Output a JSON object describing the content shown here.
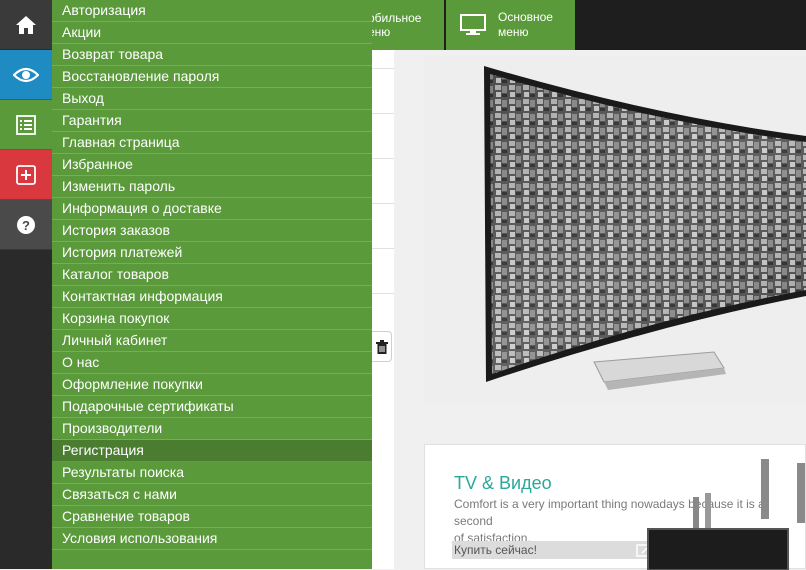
{
  "rail": {
    "items": [
      {
        "icon": "home-icon",
        "color": "#3a3a3a"
      },
      {
        "icon": "eye-icon",
        "color": "#1e8bc3"
      },
      {
        "icon": "list-icon",
        "color": "#5a9a3a"
      },
      {
        "icon": "plus-square-icon",
        "color": "#d9393e"
      },
      {
        "icon": "question-circle-icon",
        "color": "#4a4a4a"
      }
    ]
  },
  "menu": {
    "items": [
      "Авторизация",
      "Акции",
      "Возврат товара",
      "Восстановление пароля",
      "Выход",
      "Гарантия",
      "Главная страница",
      "Избранное",
      "Изменить пароль",
      "Информация о доставке",
      "История заказов",
      "История платежей",
      "Каталог товаров",
      "Контактная информация",
      "Корзина покупок",
      "Личный кабинет",
      "О нас",
      "Оформление покупки",
      "Подарочные сертификаты",
      "Производители",
      "Регистрация",
      "Результаты поиска",
      "Связаться с нами",
      "Сравнение товаров",
      "Условия использования"
    ],
    "active_index": 20
  },
  "topnav": {
    "mobile_line1": "обильное",
    "mobile_line2": "еню",
    "main_line1": "Основное",
    "main_line2": "меню",
    "main_icon": "monitor-icon"
  },
  "card": {
    "title": "TV & Видео",
    "desc": "Comfort is a very important thing nowadays because it is a second",
    "desc2": "of satisfaction.",
    "buy": "Купить сейчас!"
  },
  "colors": {
    "menu_green": "#5a9a3a",
    "active_green": "#4a7d30",
    "teal_title": "#2aa89a"
  }
}
